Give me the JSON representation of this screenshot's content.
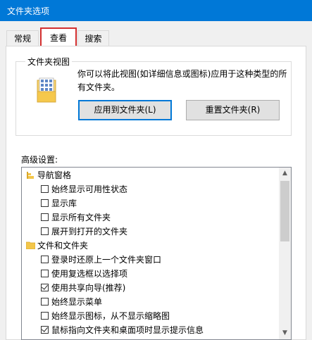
{
  "window": {
    "title": "文件夹选项"
  },
  "tabs": [
    {
      "label": "常规"
    },
    {
      "label": "查看"
    },
    {
      "label": "搜索"
    }
  ],
  "folder_view": {
    "title": "文件夹视图",
    "description": "你可以将此视图(如详细信息或图标)应用于这种类型的所有文件夹。",
    "apply_button": "应用到文件夹(L)",
    "reset_button": "重置文件夹(R)"
  },
  "advanced": {
    "label": "高级设置:",
    "items": [
      {
        "type": "category",
        "label": "导航窗格",
        "icon": "navigation-pane-icon"
      },
      {
        "type": "checkbox",
        "label": "始终显示可用性状态",
        "checked": false
      },
      {
        "type": "checkbox",
        "label": "显示库",
        "checked": false
      },
      {
        "type": "checkbox",
        "label": "显示所有文件夹",
        "checked": false
      },
      {
        "type": "checkbox",
        "label": "展开到打开的文件夹",
        "checked": false
      },
      {
        "type": "category",
        "label": "文件和文件夹",
        "icon": "folder-icon"
      },
      {
        "type": "checkbox",
        "label": "登录时还原上一个文件夹窗口",
        "checked": false
      },
      {
        "type": "checkbox",
        "label": "使用复选框以选择项",
        "checked": false
      },
      {
        "type": "checkbox",
        "label": "使用共享向导(推荐)",
        "checked": true
      },
      {
        "type": "checkbox",
        "label": "始终显示菜单",
        "checked": false
      },
      {
        "type": "checkbox",
        "label": "始终显示图标，从不显示缩略图",
        "checked": false
      },
      {
        "type": "checkbox",
        "label": "鼠标指向文件夹和桌面项时显示提示信息",
        "checked": true
      }
    ]
  },
  "colors": {
    "titlebar": "#0078d7",
    "highlight": "#d32f2f"
  }
}
